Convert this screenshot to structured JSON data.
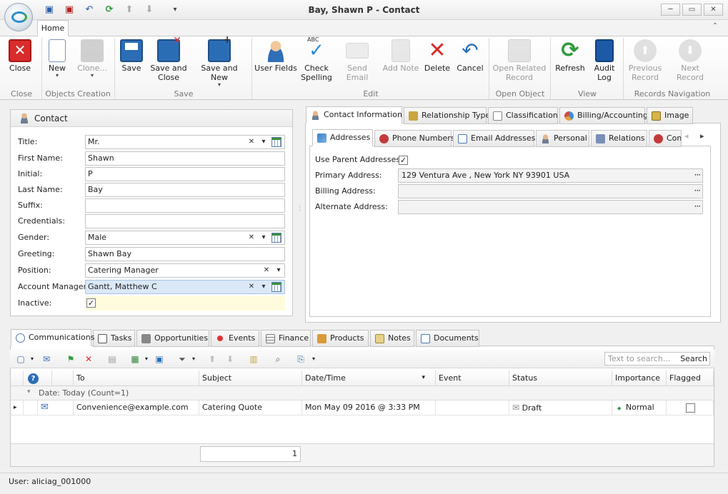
{
  "window": {
    "title": "Bay, Shawn P - Contact",
    "minimize_glyph": "─",
    "maximize_glyph": "▭",
    "close_glyph": "✕"
  },
  "quick_access": {
    "save_glyph": "▣",
    "save_close_glyph": "▣",
    "undo_glyph": "↶",
    "refresh_glyph": "⟳",
    "up_glyph": "⬆",
    "down_glyph": "⬇",
    "more_glyph": "▾"
  },
  "ribbon": {
    "tab_home": "Home",
    "collapse_glyph": "⌃",
    "buttons": {
      "close": "Close",
      "new": "New",
      "clone": "Clone...",
      "save": "Save",
      "save_and_close": "Save and Close",
      "save_and_new": "Save and New",
      "user_fields": "User Fields",
      "check_spelling": "Check Spelling",
      "send_email": "Send Email",
      "add_note": "Add Note",
      "delete": "Delete",
      "cancel": "Cancel",
      "open_related_record": "Open Related Record",
      "refresh": "Refresh",
      "audit_log": "Audit Log",
      "previous_record": "Previous Record",
      "next_record": "Next Record"
    },
    "groups": {
      "close": "Close",
      "objects_creation": "Objects Creation",
      "save": "Save",
      "edit": "Edit",
      "open_object": "Open Object",
      "view": "View",
      "records_navigation": "Records Navigation"
    },
    "abc_label": "ABC"
  },
  "contact": {
    "header": "Contact",
    "fields": {
      "title": {
        "label": "Title:",
        "value": "Mr."
      },
      "first_name": {
        "label": "First Name:",
        "value": "Shawn"
      },
      "initial": {
        "label": "Initial:",
        "value": "P"
      },
      "last_name": {
        "label": "Last Name:",
        "value": "Bay"
      },
      "suffix": {
        "label": "Suffix:",
        "value": ""
      },
      "credentials": {
        "label": "Credentials:",
        "value": ""
      },
      "gender": {
        "label": "Gender:",
        "value": "Male"
      },
      "greeting": {
        "label": "Greeting:",
        "value": "Shawn Bay"
      },
      "position": {
        "label": "Position:",
        "value": "Catering Manager"
      },
      "account_manager": {
        "label": "Account Manager:",
        "value": "Gantt, Matthew C"
      },
      "inactive": {
        "label": "Inactive:",
        "checked": true
      }
    },
    "clear_glyph": "✕",
    "dropdown_glyph": "▾",
    "check_glyph": "✓"
  },
  "right_tabs": {
    "contact_information": "Contact Information",
    "relationship_type": "Relationship Type",
    "classification": "Classification",
    "billing_accounting": "Billing/Accounting",
    "image": "Image"
  },
  "sub_tabs": {
    "addresses": "Addresses",
    "phone_numbers": "Phone Numbers",
    "email_addresses": "Email Addresses",
    "personal": "Personal",
    "relations": "Relations",
    "com": "Com",
    "prev_glyph": "◂",
    "next_glyph": "▸"
  },
  "addresses": {
    "use_parent_label": "Use Parent Addresses:",
    "use_parent_checked": true,
    "primary_label": "Primary Address:",
    "primary_value": "129 Ventura Ave , New York NY 93901 USA",
    "billing_label": "Billing Address:",
    "billing_value": "",
    "alternate_label": "Alternate Address:",
    "alternate_value": "",
    "ellipsis": "···"
  },
  "bottom_tabs": {
    "communications": "Communications",
    "tasks": "Tasks",
    "opportunities": "Opportunities",
    "events": "Events",
    "finance": "Finance",
    "products": "Products",
    "notes": "Notes",
    "documents": "Documents"
  },
  "toolbar": {
    "search_placeholder": "Text to search...",
    "search_button": "Search",
    "new_glyph": "▢",
    "mail_glyph": "✉",
    "flag_glyph": "⚑",
    "delete_glyph": "✕",
    "print_glyph": "▤",
    "grid_glyph": "▦",
    "save_glyph": "▣",
    "filter_glyph": "⏷",
    "up_glyph": "⬆",
    "down_glyph": "⬇",
    "note_glyph": "▥",
    "find_glyph": "⌕",
    "export_glyph": "⎘",
    "dropdown_glyph": "▾"
  },
  "grid": {
    "headers": {
      "help": "?",
      "to": "To",
      "subject": "Subject",
      "datetime": "Date/Time",
      "event": "Event",
      "status": "Status",
      "importance": "Importance",
      "flagged": "Flagged",
      "sort_glyph": "▾"
    },
    "group_label": "Date: Today (Count=1)",
    "group_arrow": "▾",
    "row_indicator": "▸",
    "rows": [
      {
        "to": "Convenience@example.com",
        "subject": "Catering Quote",
        "datetime": "Mon May 09 2016 @ 3:33 PM",
        "event": "",
        "status": "Draft",
        "importance": "Normal",
        "importance_glyph": "◆",
        "flagged": false,
        "mail_glyph": "✉"
      }
    ],
    "count": "1"
  },
  "status": {
    "user": "User: aliciag_001000"
  },
  "colors": {
    "accent_blue": "#2b6db5",
    "close_red": "#d92b2b",
    "refresh_green": "#2f9a3c",
    "highlight_field": "#dbe8f7",
    "inactive_bg": "#fffbdc"
  }
}
